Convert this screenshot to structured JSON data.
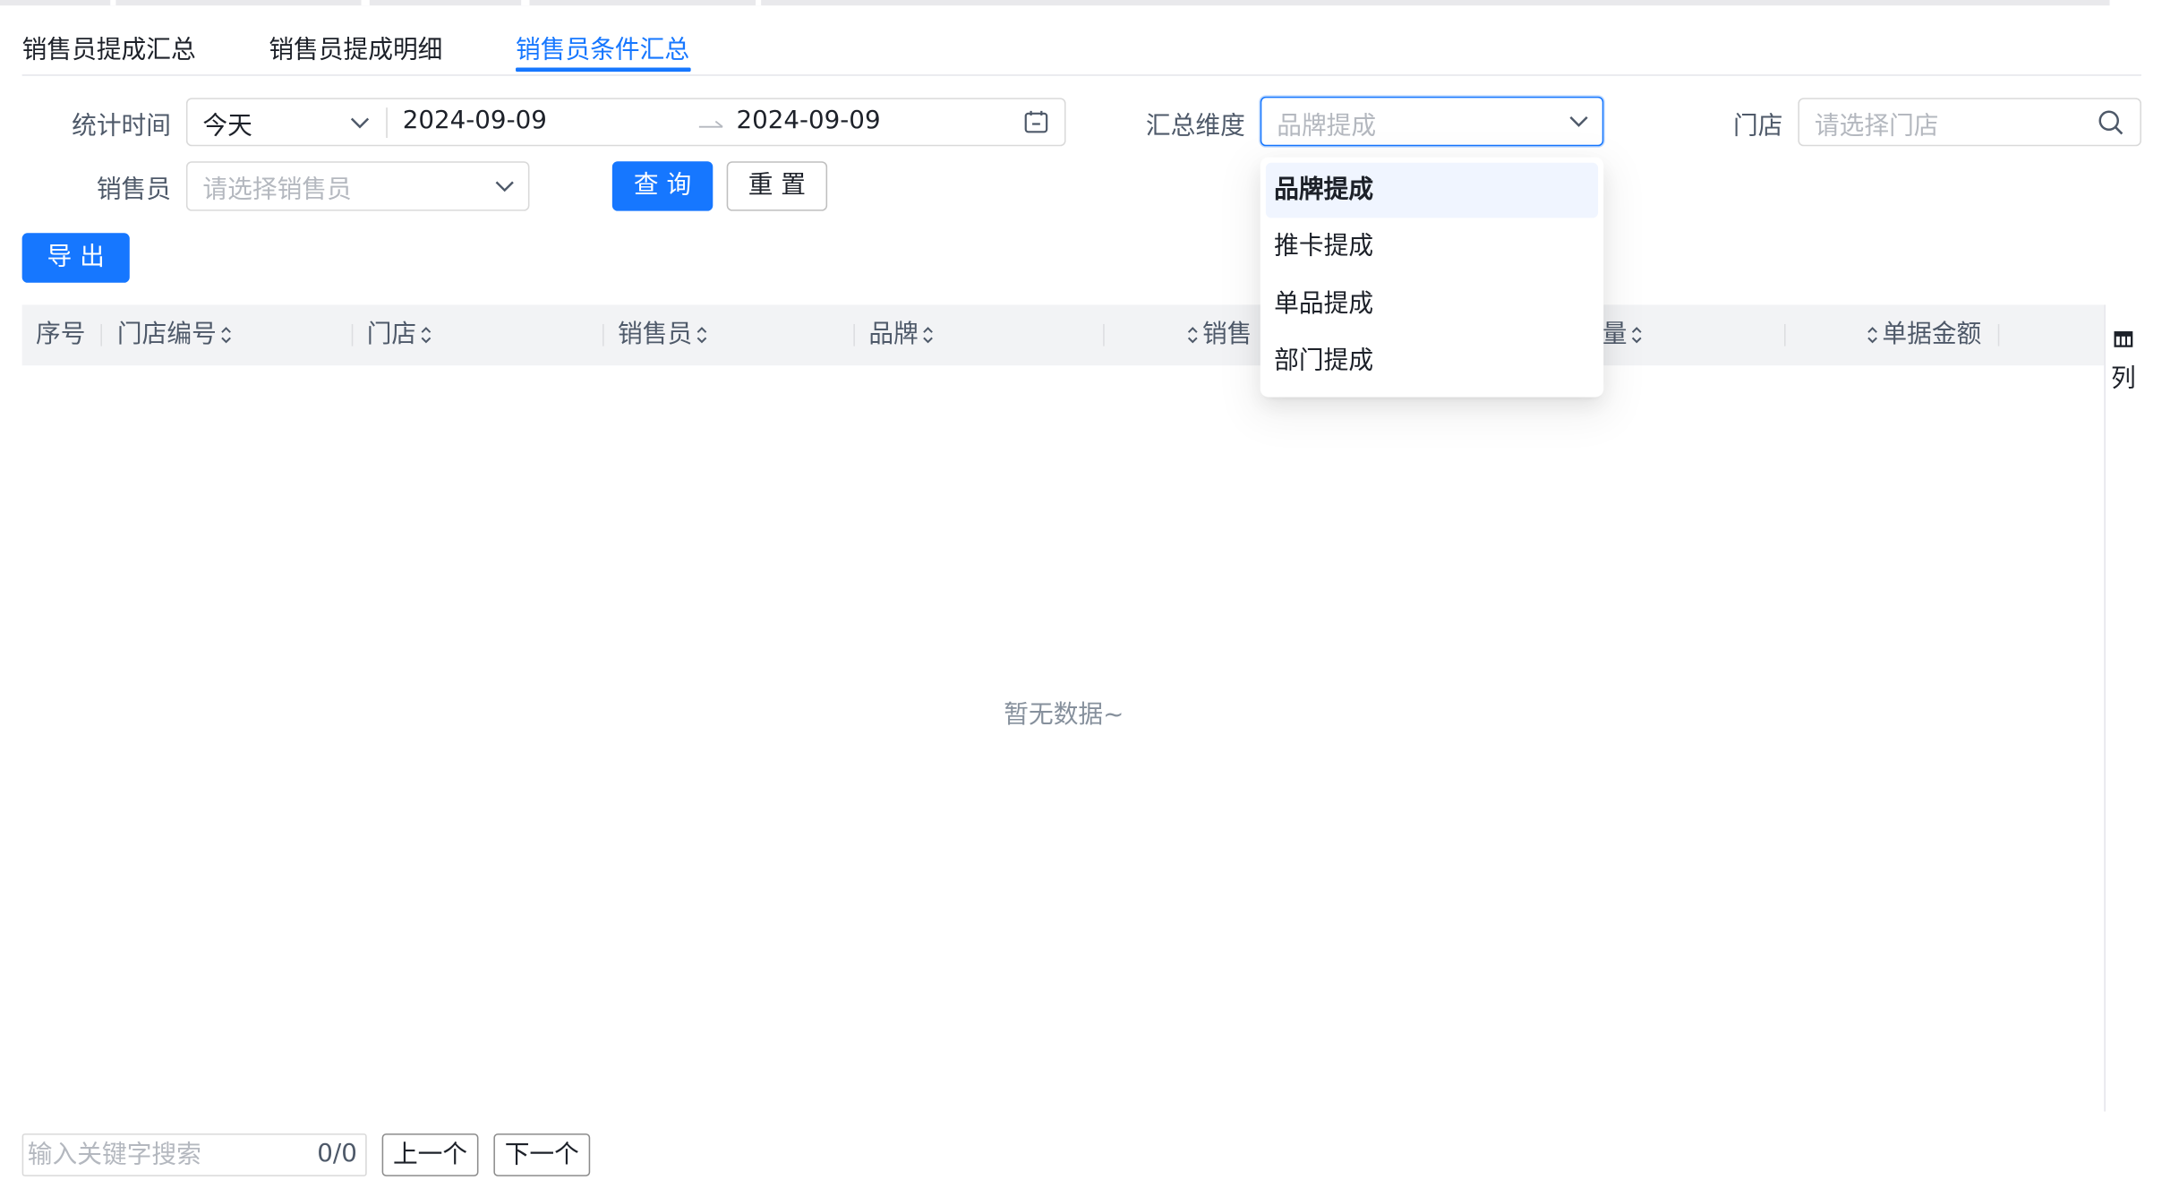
{
  "tabs": [
    {
      "label": "销售员提成汇总",
      "active": false
    },
    {
      "label": "销售员提成明细",
      "active": false
    },
    {
      "label": "销售员条件汇总",
      "active": true
    }
  ],
  "filters": {
    "stat_time_label": "统计时间",
    "period_value": "今天",
    "start_date": "2024-09-09",
    "end_date": "2024-09-09",
    "summary_dimension_label": "汇总维度",
    "summary_dimension_placeholder": "品牌提成",
    "store_label": "门店",
    "store_placeholder": "请选择门店",
    "salesperson_label": "销售员",
    "salesperson_placeholder": "请选择销售员",
    "query_button": "查 询",
    "reset_button": "重 置"
  },
  "toolbar": {
    "export_button": "导 出"
  },
  "table": {
    "columns": [
      "序号",
      "门店编号",
      "门店",
      "销售员",
      "品牌",
      "销售额",
      "数量",
      "单据金额"
    ],
    "visible_headers": {
      "index": "序号",
      "store_code": "门店编号",
      "store": "门店",
      "salesperson": "销售员",
      "brand": "品牌",
      "sales_partial": "销售",
      "quantity_partial": "量",
      "doc_amount": "单据金额"
    },
    "empty_text": "暂无数据~",
    "column_setting_label": "列"
  },
  "dropdown": {
    "options": [
      "品牌提成",
      "推卡提成",
      "单品提成",
      "部门提成"
    ],
    "selected": "品牌提成"
  },
  "bottom_search": {
    "placeholder": "输入关键字搜索",
    "count": "0/0",
    "prev_button": "上一个",
    "next_button": "下一个"
  },
  "colors": {
    "accent": "#1677ff",
    "header_bg": "#f2f3f5",
    "placeholder": "#b4b8bf"
  }
}
